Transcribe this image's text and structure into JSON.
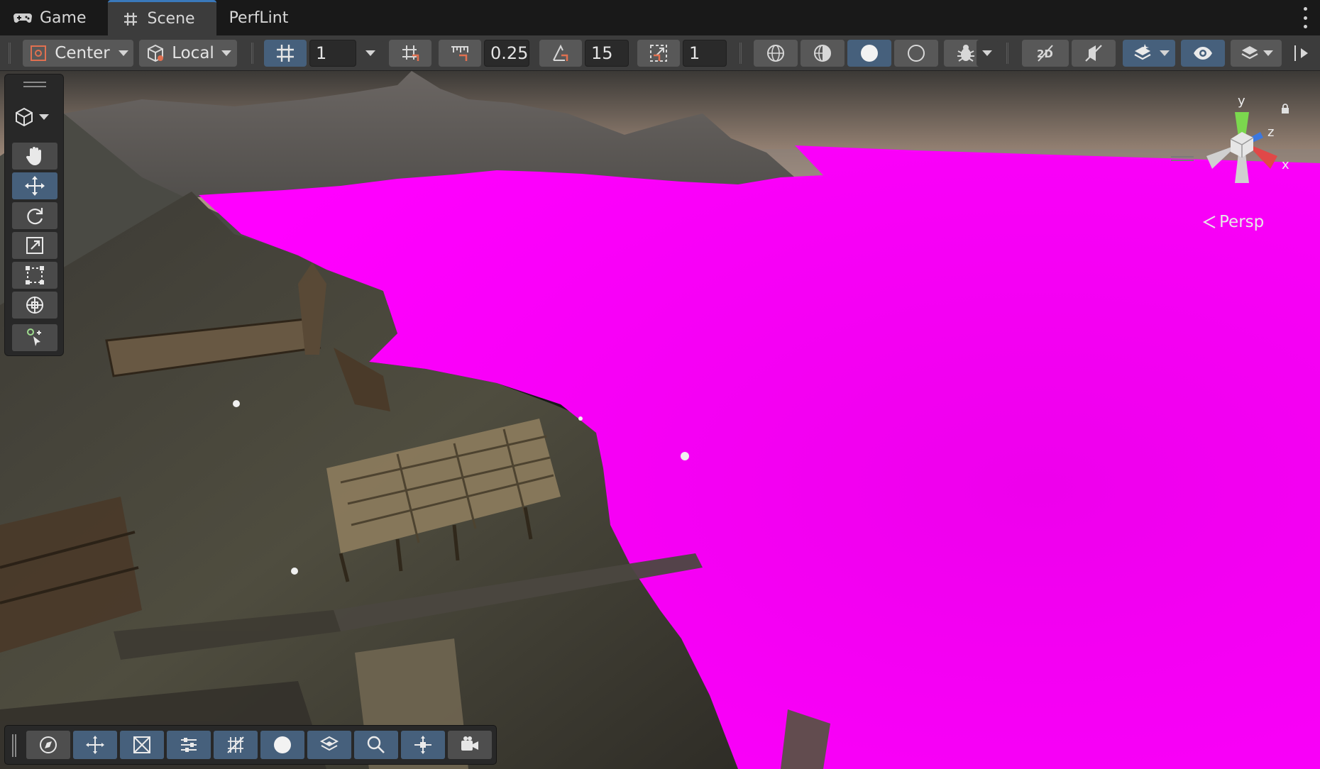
{
  "tabs": [
    {
      "label": "Game",
      "icon": "gamepad-icon",
      "active": false
    },
    {
      "label": "Scene",
      "icon": "grid-hash-icon",
      "active": true
    },
    {
      "label": "PerfLint",
      "icon": "",
      "active": false
    }
  ],
  "toolbar": {
    "pivot_label": "Center",
    "rotation_label": "Local",
    "grid_size_value": "1",
    "snap_increment_value": "0.25",
    "rotate_snap_value": "15",
    "scale_snap_value": "1"
  },
  "viewport": {
    "projection_label": "Persp",
    "axis_labels": {
      "y": "y",
      "z": "z",
      "x": "x"
    },
    "colors": {
      "water_magenta": "#ff00ff",
      "sky_warm": "#c9a98c",
      "terrain": "#4f4d3f",
      "mountain": "#6b6663"
    }
  },
  "palette_tools": [
    "view-tool-icon",
    "move-tool-icon",
    "rotate-tool-icon",
    "scale-tool-icon",
    "rect-tool-icon",
    "transform-tool-icon",
    "custom-tool-icon"
  ],
  "bottom_tools": [
    "compass-icon",
    "move-axes-icon",
    "snap-scale-icon",
    "sliders-icon",
    "grid-snap-icon",
    "sphere-icon",
    "layers-icon",
    "search-icon",
    "pivot-icon",
    "camera-icon"
  ],
  "accent_color": "#46607c"
}
